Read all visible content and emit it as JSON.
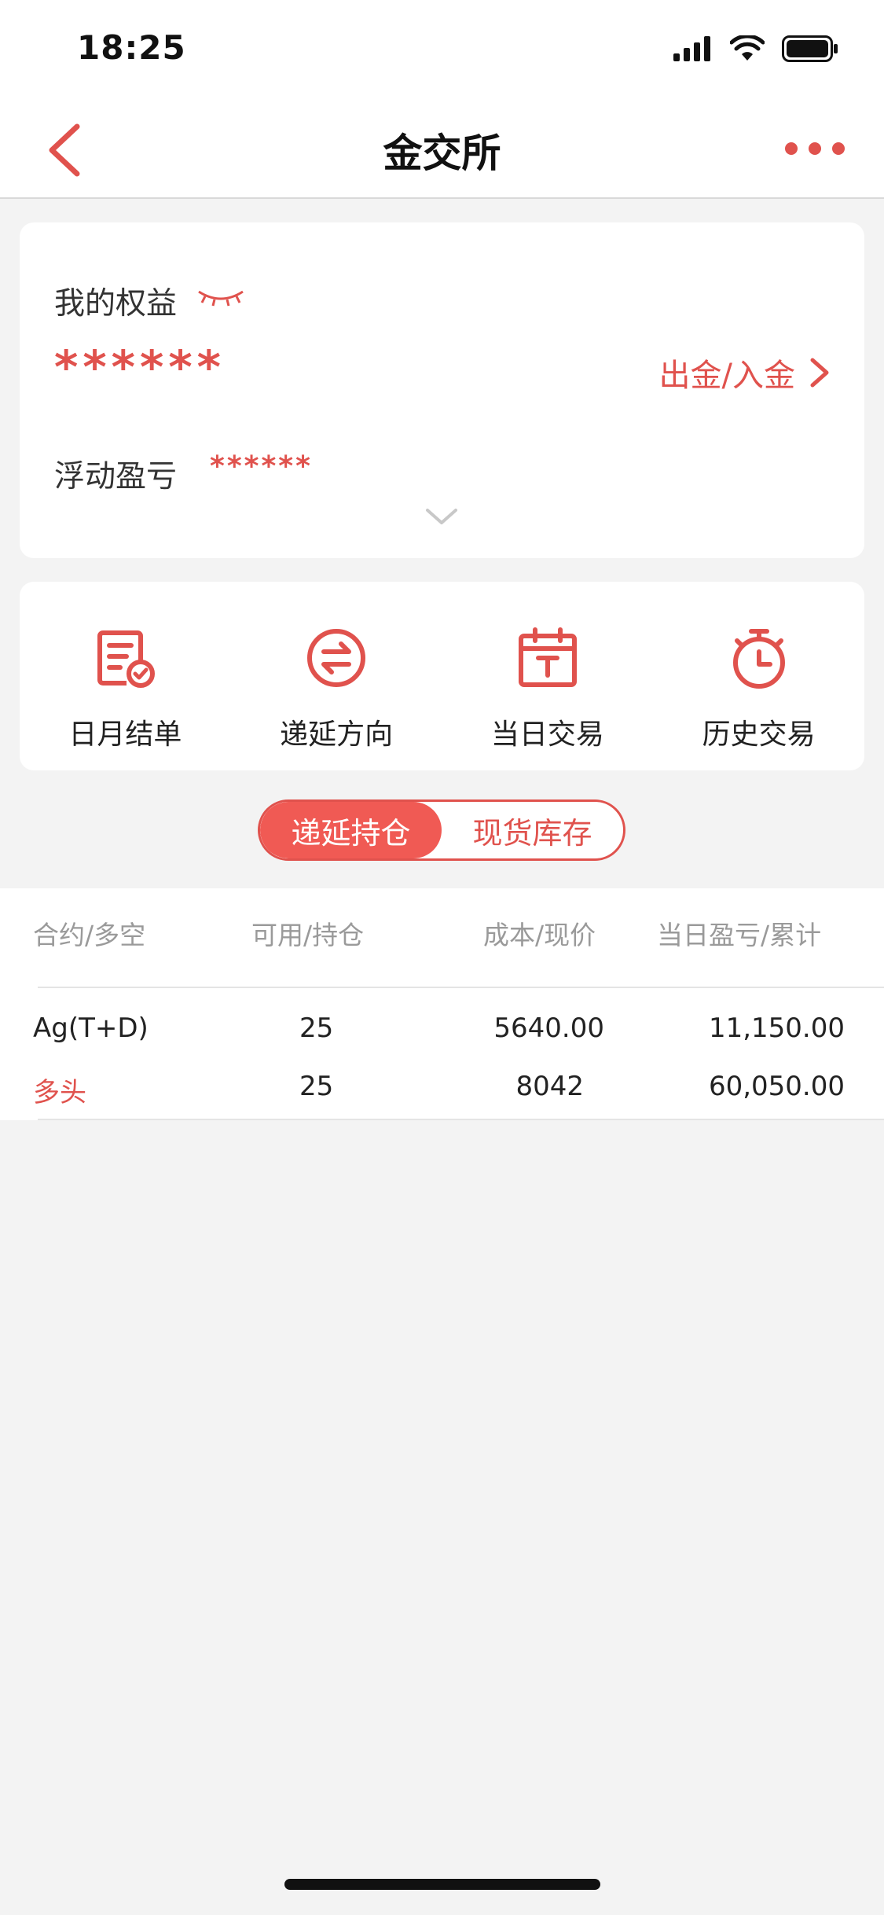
{
  "status": {
    "time": "18:25"
  },
  "nav": {
    "title": "金交所"
  },
  "equity": {
    "label": "我的权益",
    "value": "******",
    "transfer_label": "出金/入金",
    "float_label": "浮动盈亏",
    "float_value": "******"
  },
  "actions": [
    {
      "label": "日月结单",
      "icon": "statement-icon"
    },
    {
      "label": "递延方向",
      "icon": "exchange-icon"
    },
    {
      "label": "当日交易",
      "icon": "calendar-icon"
    },
    {
      "label": "历史交易",
      "icon": "timer-icon"
    }
  ],
  "segment": {
    "active": "递延持仓",
    "inactive": "现货库存"
  },
  "table": {
    "headers": [
      "合约/多空",
      "可用/持仓",
      "成本/现价",
      "当日盈亏/累计"
    ],
    "rows": [
      {
        "contract": "Ag(T+D)",
        "available": "25",
        "cost": "5640.00",
        "pnl_today": "11,150.00"
      },
      {
        "contract": "多头",
        "available": "25",
        "cost": "8042",
        "pnl_today": "60,050.00"
      }
    ]
  },
  "colors": {
    "accent": "#e0524d",
    "background": "#f3f3f3"
  }
}
